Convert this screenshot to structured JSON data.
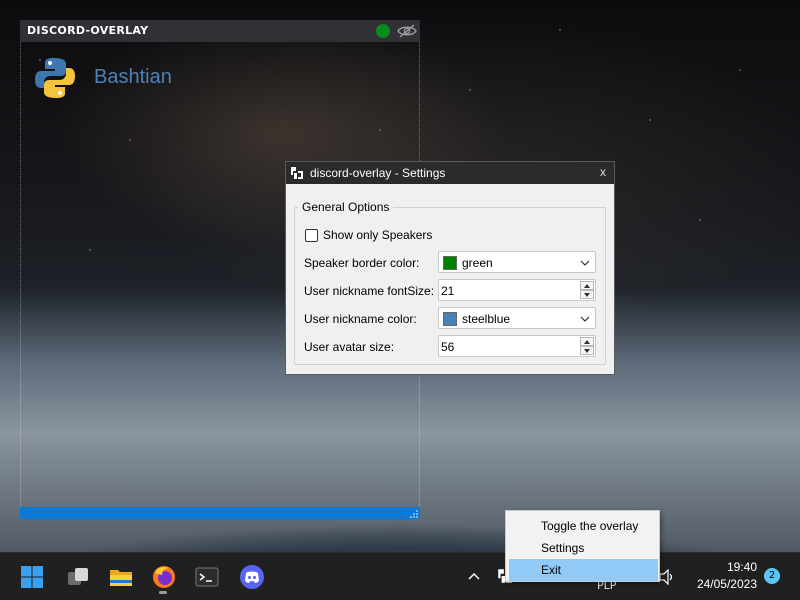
{
  "overlay": {
    "title": "DISCORD-OVERLAY",
    "status_color": "#0a8a1a",
    "visibility_icon": "eye-slash-icon",
    "speaker": {
      "name": "Bashtian",
      "avatar_icon": "python-logo-icon"
    },
    "accent_color": "#0a7ad6"
  },
  "settings": {
    "title": "discord-overlay - Settings",
    "close_label": "x",
    "group_title": "General Options",
    "show_only_speakers": {
      "label": "Show only Speakers",
      "checked": false
    },
    "speaker_border_color": {
      "label": "Speaker border color:",
      "value": "green",
      "swatch": "#008000"
    },
    "nickname_font_size": {
      "label": "User nickname fontSize:",
      "value": "21"
    },
    "nickname_color": {
      "label": "User nickname color:",
      "value": "steelblue",
      "swatch": "#4682b4"
    },
    "avatar_size": {
      "label": "User avatar size:",
      "value": "56"
    }
  },
  "context_menu": {
    "items": [
      {
        "label": "Toggle the overlay",
        "highlighted": false
      },
      {
        "label": "Settings",
        "highlighted": false
      },
      {
        "label": "Exit",
        "highlighted": true
      }
    ]
  },
  "taskbar": {
    "apps": [
      "windows-start-icon",
      "task-view-icon",
      "file-explorer-icon",
      "firefox-icon",
      "terminal-icon",
      "discord-icon"
    ],
    "language": "PLP",
    "time": "19:40",
    "date": "24/05/2023",
    "notification_count": "2"
  }
}
